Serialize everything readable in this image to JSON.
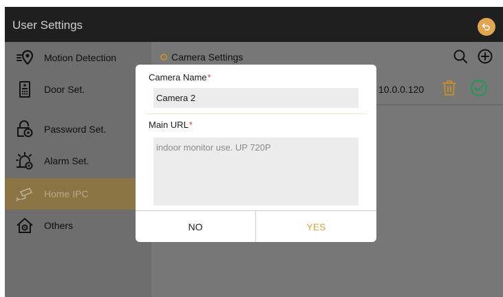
{
  "header": {
    "title": "User Settings",
    "back_icon": "back-arrow-icon",
    "accent": "#e1a452"
  },
  "sidebar": {
    "items": [
      {
        "label": "Motion Detection",
        "icon": "motion-detection-icon"
      },
      {
        "label": "Door Set.",
        "icon": "door-panel-icon"
      },
      {
        "label": "Password Set.",
        "icon": "lock-gear-icon"
      },
      {
        "label": "Alarm Set.",
        "icon": "alarm-gear-icon"
      },
      {
        "label": "Home IPC",
        "icon": "ip-camera-icon",
        "active": true
      },
      {
        "label": "Others",
        "icon": "house-gear-icon"
      }
    ]
  },
  "content": {
    "section_title": "Camera Settings",
    "camera_row": {
      "ip": "10.0.0.120"
    }
  },
  "dialog": {
    "name_label": "Camera Name",
    "name_value": "Camera 2",
    "url_label": "Main URL",
    "url_value": "indoor monitor use. UP 720P",
    "required_mark": "*",
    "no_label": "NO",
    "yes_label": "YES"
  },
  "colors": {
    "active_item": "#8a7443",
    "yes_text": "#d9a63c",
    "required": "#d63a3a"
  }
}
